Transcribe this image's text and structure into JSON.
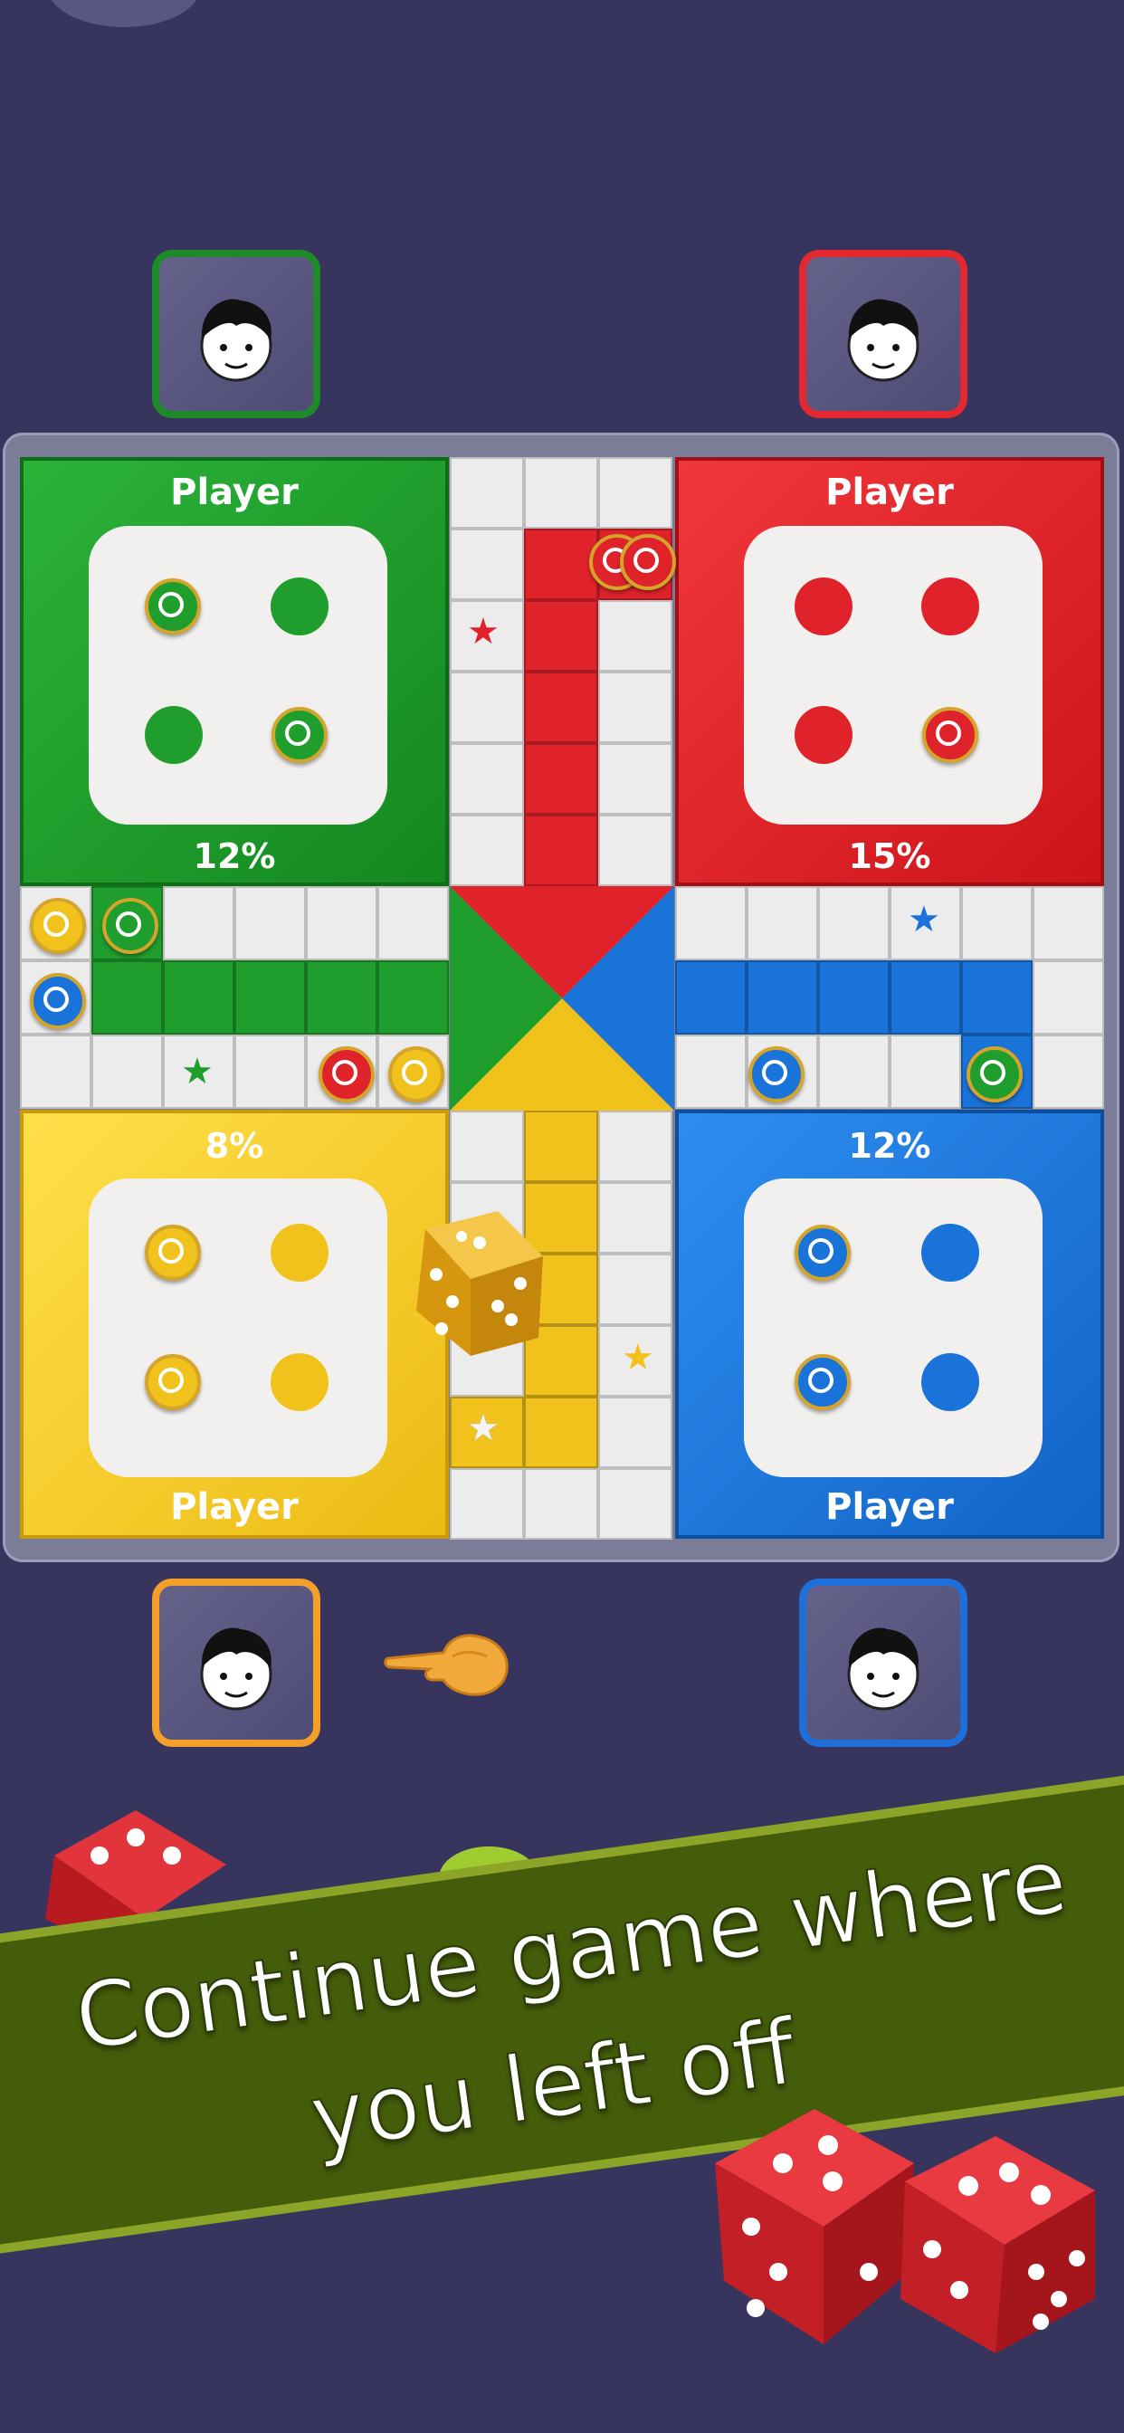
{
  "players": {
    "green": {
      "name": "Player",
      "percent": "12%",
      "color": "#1f9e2e"
    },
    "red": {
      "name": "Player",
      "percent": "15%",
      "color": "#e0232a"
    },
    "yellow": {
      "name": "Player",
      "percent": "8%",
      "color": "#f1c21b"
    },
    "blue": {
      "name": "Player",
      "percent": "12%",
      "color": "#1a73d9"
    }
  },
  "avatars": {
    "green": {
      "border": "#1f8a2a",
      "icon": "face-icon"
    },
    "red": {
      "border": "#e32830",
      "icon": "face-icon"
    },
    "yellow": {
      "border": "#f3a02b",
      "icon": "face-icon"
    },
    "blue": {
      "border": "#1d6fd9",
      "icon": "face-icon"
    }
  },
  "turn_indicator": {
    "icon": "pointing-hand-icon",
    "player": "yellow"
  },
  "dice": {
    "color": "#e8ae1a",
    "value": 3
  },
  "banner": {
    "line1": "Continue game where",
    "line2": "you left off",
    "bg": "#445d0b",
    "stripe": "#8ca428"
  },
  "decorations": {
    "dice_color": "#d8242a"
  }
}
